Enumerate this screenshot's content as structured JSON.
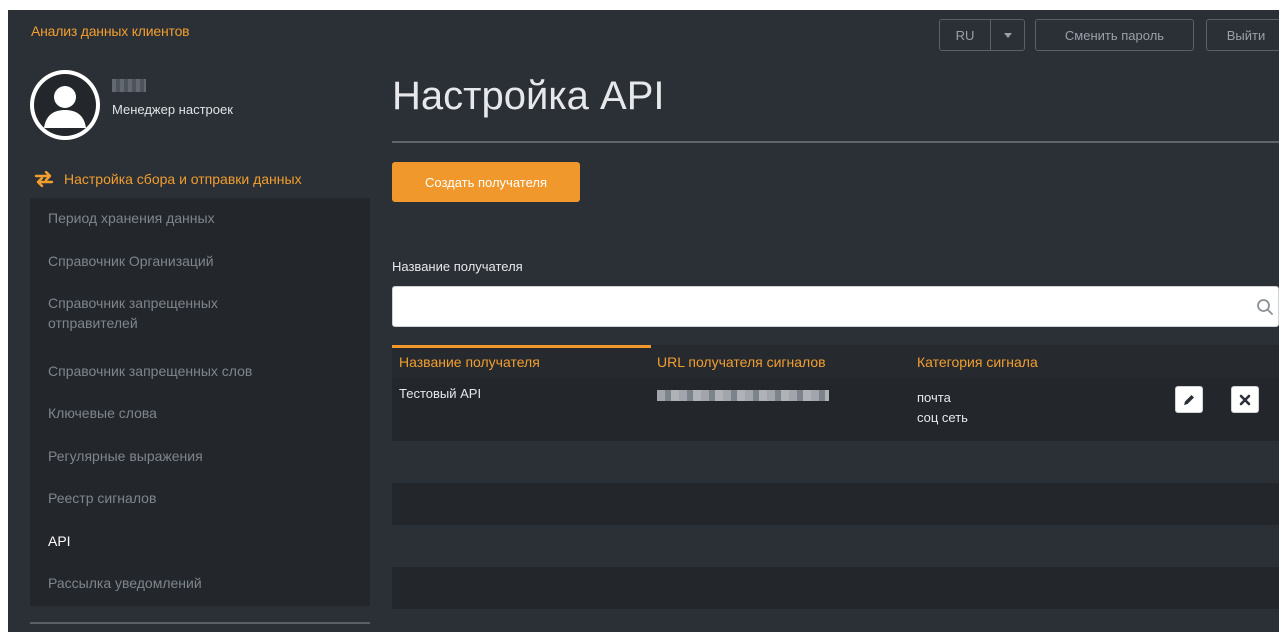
{
  "app": {
    "title": "Анализ данных клиентов",
    "lang": "RU",
    "change_password": "Сменить пароль",
    "logout": "Выйти"
  },
  "profile": {
    "role": "Менеджер настроек"
  },
  "sidebar": {
    "section_title": "Настройка сбора и отправки данных",
    "items": [
      {
        "label": "Период хранения данных"
      },
      {
        "label": "Справочник Организаций"
      },
      {
        "label": "Справочник запрещенных отправителей"
      },
      {
        "label": "Справочник запрещенных слов"
      },
      {
        "label": "Ключевые слова"
      },
      {
        "label": "Регулярные выражения"
      },
      {
        "label": "Реестр сигналов"
      },
      {
        "label": "API"
      },
      {
        "label": "Рассылка уведомлений"
      }
    ],
    "active_index": 7
  },
  "main": {
    "title": "Настройка API",
    "create_button": "Создать получателя",
    "filter_label": "Название получателя",
    "search_value": "",
    "table": {
      "columns": [
        "Название получателя",
        "URL получателя сигналов",
        "Категория сигнала"
      ],
      "rows": [
        {
          "name": "Тестовый API",
          "categories": [
            "почта",
            "соц сеть"
          ]
        }
      ]
    }
  },
  "colors": {
    "accent": "#f29e2e",
    "background": "#2b3036",
    "sidebar_bg": "#23272c"
  }
}
